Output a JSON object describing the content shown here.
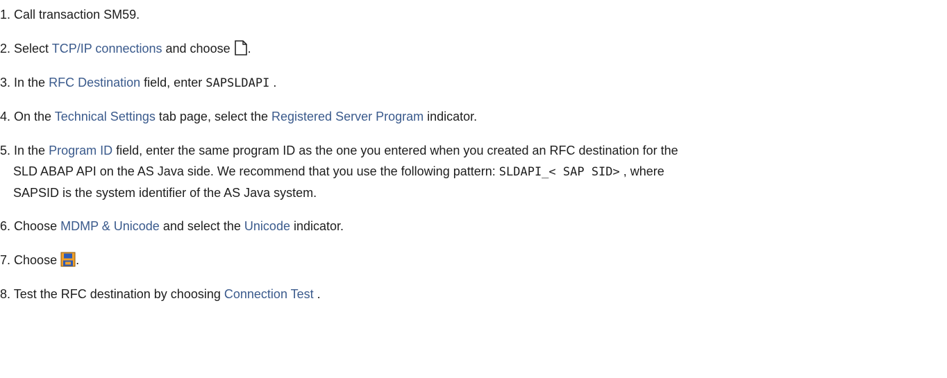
{
  "steps": [
    {
      "num": "1.",
      "text": "Call transaction SM59."
    },
    {
      "num": "2.",
      "pre": "Select",
      "ui": "TCP/IP connections",
      "post": "and choose",
      "icon": "new-document-icon",
      "end": "."
    },
    {
      "num": "3.",
      "pre": "In the",
      "ui": "RFC Destination",
      "post": "field, enter",
      "code": "SAPSLDAPI",
      "end": "."
    },
    {
      "num": "4.",
      "pre": "On the",
      "ui": "Technical Settings",
      "mid": "tab page, select the",
      "ui2": "Registered Server Program",
      "post": "indicator."
    },
    {
      "num": "5.",
      "pre": "In the",
      "ui": "Program ID",
      "post": "field, enter the same program ID as the one you entered when you created an RFC destination for the",
      "line2_pre": "SLD ABAP API on the AS Java side. We recommend that you use the following pattern:",
      "code": "SLDAPI_< SAP SID>",
      "line2_post": ", where",
      "line3": "SAPSID is the system identifier of the AS Java system."
    },
    {
      "num": "6.",
      "pre": "Choose",
      "ui": "MDMP & Unicode",
      "mid": "and select the",
      "ui2": "Unicode",
      "post": "indicator."
    },
    {
      "num": "7.",
      "pre": "Choose",
      "icon": "save-icon",
      "end": "."
    },
    {
      "num": "8.",
      "pre": "Test the RFC destination by choosing",
      "ui": "Connection Test",
      "end": "."
    }
  ],
  "colors": {
    "ui_link": "#3a5a8c",
    "text": "#1d1d1d",
    "save_icon_orange": "#f0a02a",
    "save_icon_blue": "#2c5bb8"
  }
}
